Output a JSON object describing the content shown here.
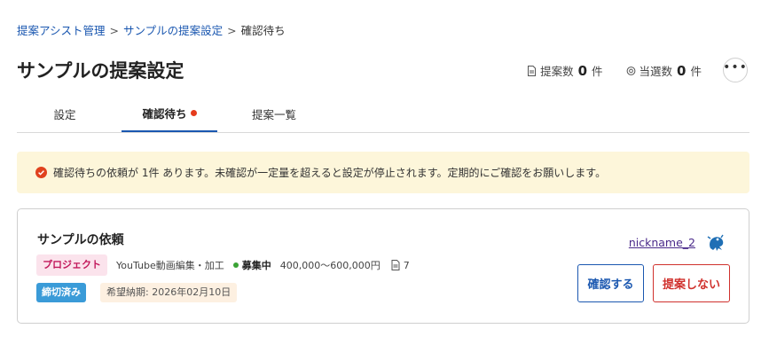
{
  "breadcrumb": {
    "items": [
      "提案アシスト管理",
      "サンプルの提案設定"
    ],
    "separator": ">",
    "current": "確認待ち"
  },
  "page": {
    "title": "サンプルの提案設定"
  },
  "stats": {
    "proposals": {
      "label": "提案数",
      "value": "0",
      "unit": "件"
    },
    "selected": {
      "label": "当選数",
      "value": "0",
      "unit": "件"
    }
  },
  "more_button": {
    "label": "•••"
  },
  "tabs": [
    {
      "label": "設定",
      "active": false
    },
    {
      "label": "確認待ち",
      "active": true,
      "has_notification": true
    },
    {
      "label": "提案一覧",
      "active": false
    }
  ],
  "alert": {
    "text": "確認待ちの依頼が 1件 あります。未確認が一定量を超えると設定が停止されます。定期的にご確認をお願いします。",
    "color": "#e0421e",
    "background": "#fdf6da"
  },
  "request": {
    "title": "サンプルの依頼",
    "type_badge": "プロジェクト",
    "category": "YouTube動画編集・加工",
    "status": "募集中",
    "budget": "400,000〜600,000円",
    "proposal_count": "7",
    "closed_badge": "締切済み",
    "deadline": "希望納期: 2026年02月10日",
    "user": {
      "nickname": "nickname_2"
    },
    "confirm_button": "確認する",
    "decline_button": "提案しない"
  },
  "colors": {
    "link": "#1a57b0",
    "active_tab_underline": "#1a57b0",
    "notification_dot": "#e53b1c",
    "status_open": "#3aa335",
    "closed_badge": "#3a9bd8",
    "decline": "#d0312d"
  }
}
